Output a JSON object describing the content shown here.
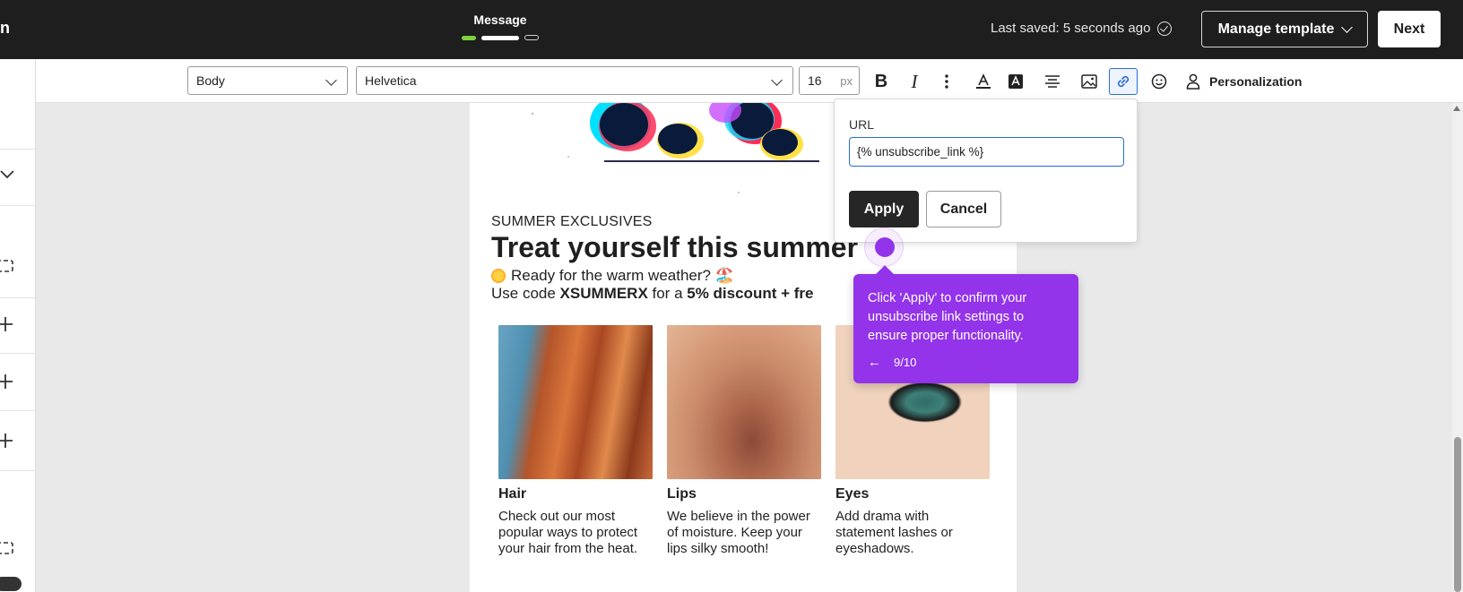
{
  "topbar": {
    "app_name_fragment": "n",
    "step_title": "Message",
    "last_saved": "Last saved: 5 seconds ago",
    "manage_template_label": "Manage template",
    "next_label": "Next"
  },
  "toolbar": {
    "style_select": "Body",
    "font_select": "Helvetica",
    "font_size": "16",
    "font_size_unit": "px",
    "personalization_label": "Personalization",
    "icons": [
      "bold-icon",
      "italic-icon",
      "more-vertical-icon",
      "text-color-icon",
      "highlight-color-icon",
      "align-center-icon",
      "image-icon",
      "link-icon",
      "emoji-icon",
      "person-icon"
    ]
  },
  "link_popover": {
    "label": "URL",
    "value": "{% unsubscribe_link %}",
    "apply_label": "Apply",
    "cancel_label": "Cancel"
  },
  "email": {
    "eyebrow": "SUMMER EXCLUSIVES",
    "headline": "Treat yourself this summer",
    "line1": "Ready for the warm weather? 🏖️",
    "line2_prefix": "Use code ",
    "promo_code": "XSUMMERX",
    "line2_middle": " for a ",
    "discount_text": "5% discount + fre",
    "cards": [
      {
        "title": "Hair",
        "body": "Check out our most popular ways to protect your hair from the heat."
      },
      {
        "title": "Lips",
        "body": "We believe in the power of moisture. Keep your lips silky smooth!"
      },
      {
        "title": "Eyes",
        "body": "Add drama with statement lashes or eyeshadows."
      }
    ]
  },
  "guide": {
    "tooltip_text": "Click 'Apply' to confirm your unsubscribe link settings to ensure proper functionality.",
    "step_counter": "9/10"
  },
  "colors": {
    "topbar_bg": "#1e1e1e",
    "accent_purple": "#9333ea",
    "link_blue": "#2a6bd6",
    "step_done_green": "#7fd33a"
  }
}
